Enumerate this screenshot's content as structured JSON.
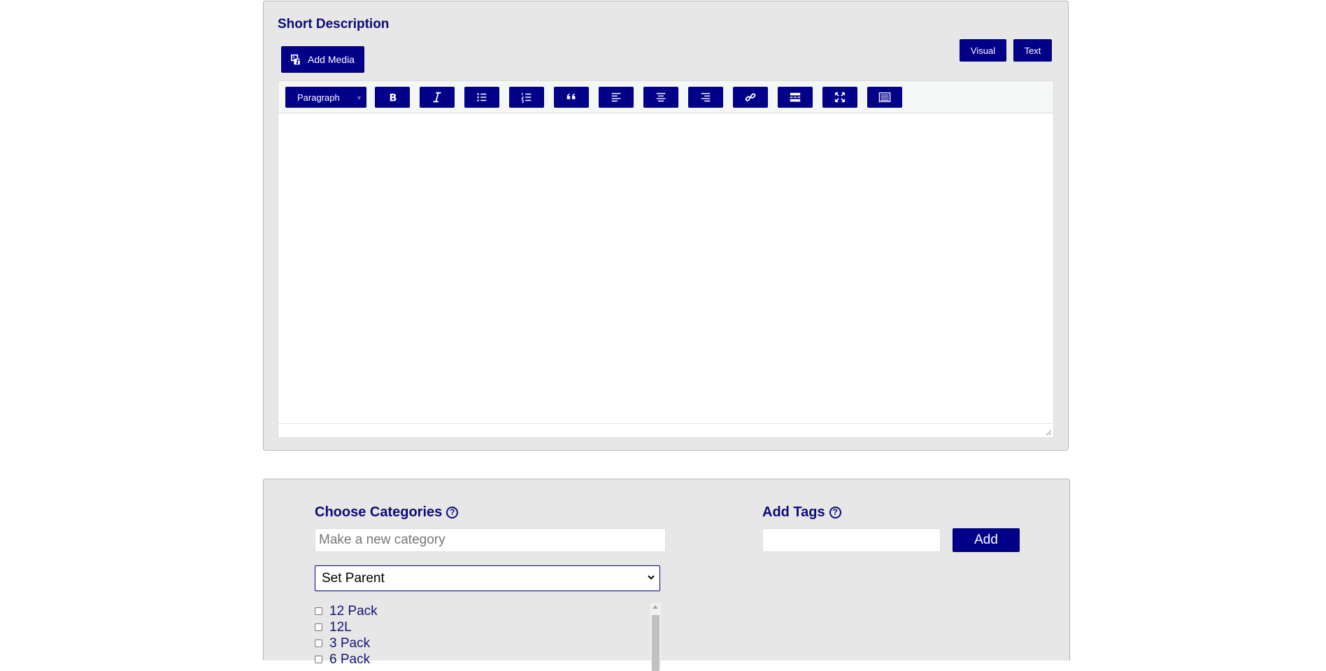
{
  "short_description": {
    "title": "Short Description",
    "add_media_label": "Add Media",
    "tabs": {
      "visual": "Visual",
      "text": "Text"
    },
    "toolbar": {
      "format_value": "Paragraph",
      "buttons": [
        {
          "name": "bold-button",
          "icon": "bold-icon"
        },
        {
          "name": "italic-button",
          "icon": "italic-icon"
        },
        {
          "name": "bullet-list-button",
          "icon": "bullet-list-icon"
        },
        {
          "name": "numbered-list-button",
          "icon": "numbered-list-icon"
        },
        {
          "name": "blockquote-button",
          "icon": "quote-icon"
        },
        {
          "name": "align-left-button",
          "icon": "align-left-icon"
        },
        {
          "name": "align-center-button",
          "icon": "align-center-icon"
        },
        {
          "name": "align-right-button",
          "icon": "align-right-icon"
        },
        {
          "name": "insert-link-button",
          "icon": "link-icon"
        },
        {
          "name": "read-more-button",
          "icon": "read-more-icon"
        },
        {
          "name": "fullscreen-button",
          "icon": "fullscreen-icon"
        },
        {
          "name": "toolbar-toggle-button",
          "icon": "kitchen-sink-icon"
        }
      ]
    }
  },
  "categories": {
    "label": "Choose Categories",
    "help": "?",
    "new_category_placeholder": "Make a new category",
    "parent_select_value": "Set Parent",
    "items": [
      "12 Pack",
      "12L",
      "3 Pack",
      "6 Pack"
    ]
  },
  "tags": {
    "label": "Add Tags",
    "help": "?",
    "input_value": "",
    "add_button_label": "Add"
  },
  "colors": {
    "accent": "#020088",
    "panel": "#e7e7e7",
    "heading": "#0b0b7a"
  }
}
